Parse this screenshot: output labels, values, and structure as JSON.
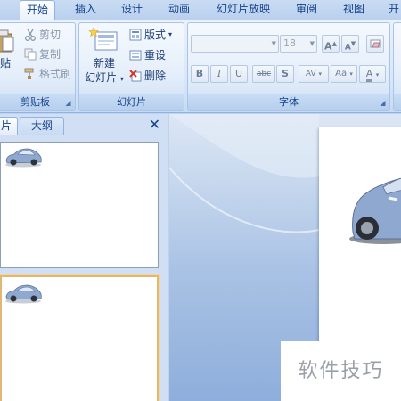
{
  "tabs": [
    {
      "label": "开始",
      "active": true
    },
    {
      "label": "插入"
    },
    {
      "label": "设计"
    },
    {
      "label": "动画"
    },
    {
      "label": "幻灯片放映"
    },
    {
      "label": "审阅"
    },
    {
      "label": "视图"
    },
    {
      "label": "开"
    }
  ],
  "clipboard": {
    "paste_label": "贴",
    "cut_label": "剪切",
    "copy_label": "复制",
    "format_painter_label": "格式刷",
    "group_label": "剪贴板"
  },
  "slides_group": {
    "new_slide_line1": "新建",
    "new_slide_line2": "幻灯片",
    "layout_label": "版式",
    "reset_label": "重设",
    "delete_label": "删除",
    "group_label": "幻灯片"
  },
  "font_group": {
    "font_size_value": "18",
    "group_label": "字体",
    "grow_label": "A",
    "shrink_label": "A",
    "clear_label": "",
    "bold_label": "B",
    "italic_label": "I",
    "underline_label": "U",
    "strike_label": "abc",
    "shadow_label": "S",
    "spacing_label": "AV",
    "case_label": "Aa",
    "color_label": "A"
  },
  "panel": {
    "tab_slides_label": "片",
    "tab_outline_label": "大纲",
    "close_label": "✕"
  },
  "watermark": {
    "text": "软件技巧"
  },
  "colors": {
    "ribbon": "#dbe8f8",
    "tab_text": "#15428b",
    "selection_border": "#e1b774",
    "car_body": "#8fa8cf"
  }
}
